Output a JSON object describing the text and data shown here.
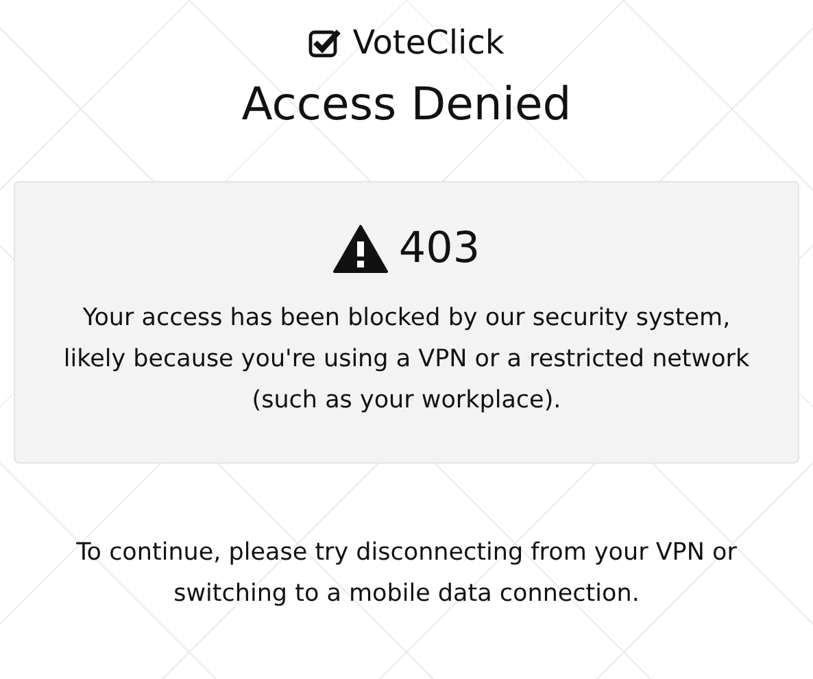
{
  "brand": {
    "name": "VoteClick"
  },
  "title": "Access Denied",
  "error": {
    "code": "403",
    "message": "Your access has been blocked by our security system, likely because you're using a VPN or a restricted network (such as your workplace)."
  },
  "instructions": "To continue, please try disconnecting from your VPN or switching to a mobile data connection."
}
